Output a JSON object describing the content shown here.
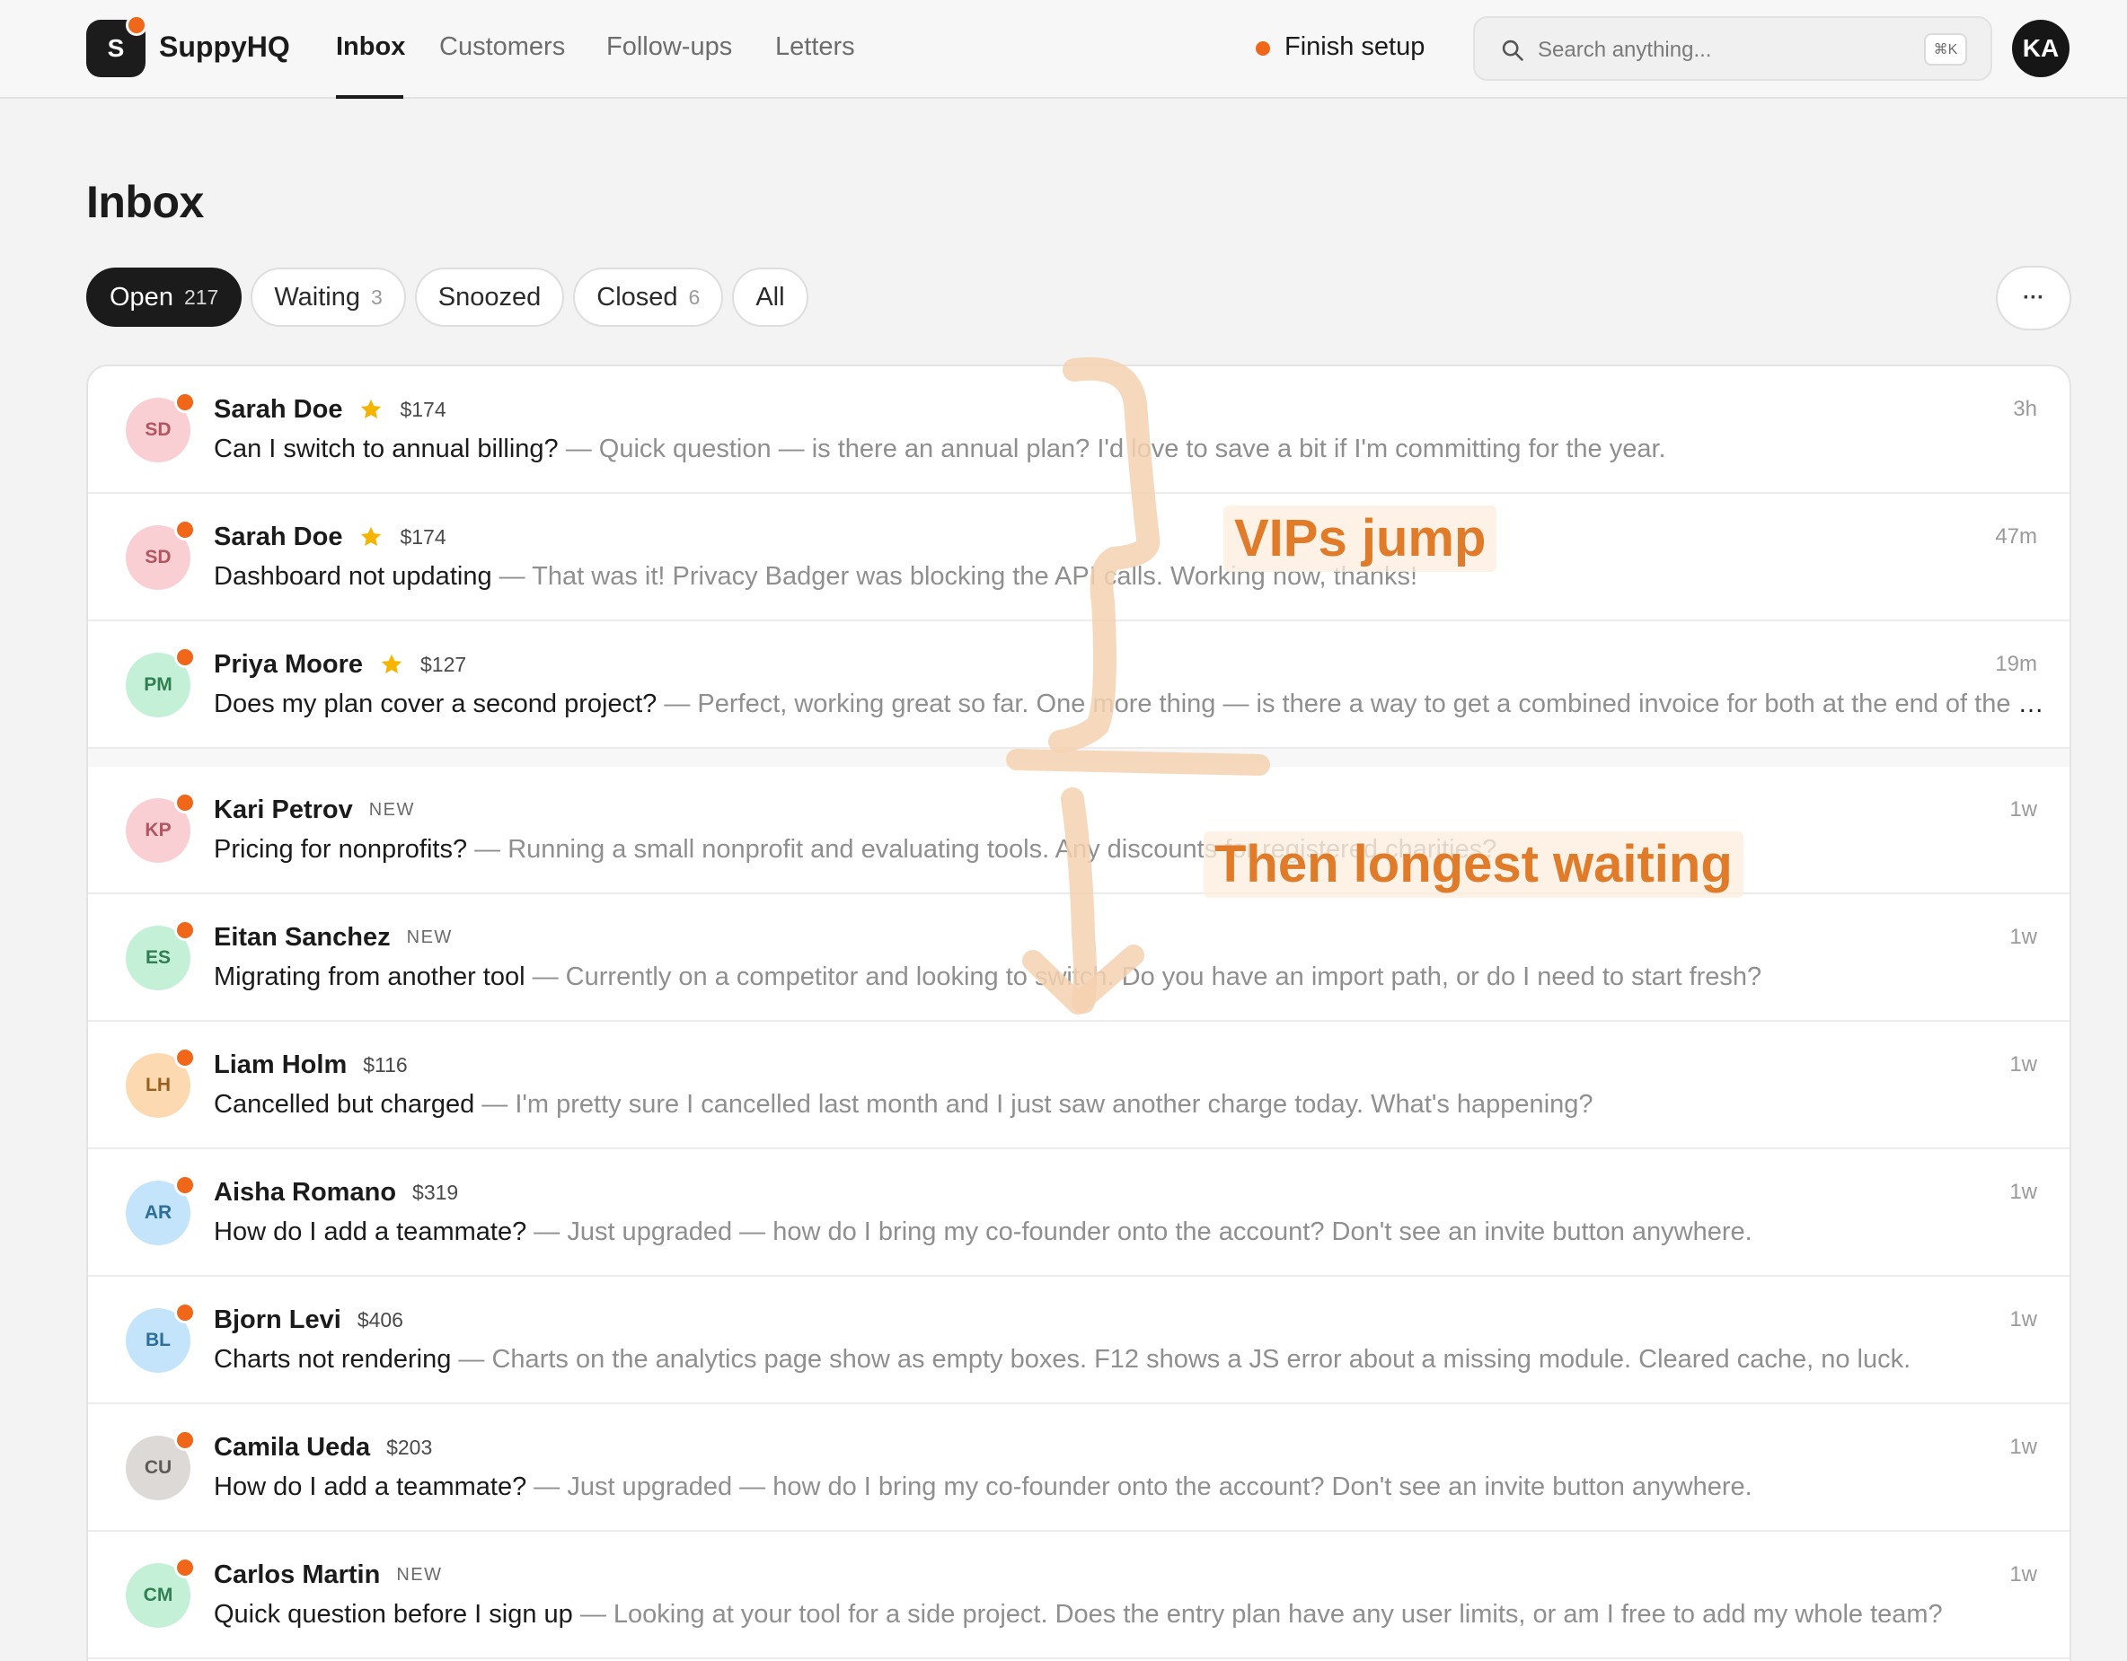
{
  "topbar": {
    "logo_letter": "S",
    "brand": "SuppyHQ",
    "nav": [
      {
        "label": "Inbox",
        "active": true
      },
      {
        "label": "Customers",
        "active": false
      },
      {
        "label": "Follow-ups",
        "active": false
      },
      {
        "label": "Letters",
        "active": false
      }
    ],
    "setup_label": "Finish setup",
    "search_placeholder": "Search anything...",
    "search_shortcut": "⌘K",
    "user_initials": "KA"
  },
  "page_title": "Inbox",
  "filters": [
    {
      "label": "Open",
      "count": "217",
      "active": true
    },
    {
      "label": "Waiting",
      "count": "3",
      "active": false
    },
    {
      "label": "Snoozed",
      "count": "",
      "active": false
    },
    {
      "label": "Closed",
      "count": "6",
      "active": false
    },
    {
      "label": "All",
      "count": "",
      "active": false
    }
  ],
  "more_label": "···",
  "conversations": [
    {
      "initials": "SD",
      "avatar_bg": "#f9cfd4",
      "avatar_fg": "#b3555f",
      "name": "Sarah Doe",
      "vip": true,
      "value": "$174",
      "badge": "",
      "subject": "Can I switch to annual billing?",
      "preview": " — Quick question — is there an annual plan? I'd love to save a bit if I'm committing for the year.",
      "time": "3h"
    },
    {
      "initials": "SD",
      "avatar_bg": "#f9cfd4",
      "avatar_fg": "#b3555f",
      "name": "Sarah Doe",
      "vip": true,
      "value": "$174",
      "badge": "",
      "subject": "Dashboard not updating",
      "preview": " — That was it! Privacy Badger was blocking the API calls. Working now, thanks!",
      "time": "47m"
    },
    {
      "initials": "PM",
      "avatar_bg": "#c3f0d6",
      "avatar_fg": "#2f7f52",
      "name": "Priya Moore",
      "vip": true,
      "value": "$127",
      "badge": "",
      "subject": "Does my plan cover a second project?",
      "preview": " — Perfect, working great so far. One more thing — is there a way to get a combined invoice for both at the end of the month?",
      "time": "19m"
    },
    {
      "initials": "KP",
      "avatar_bg": "#f9cfd4",
      "avatar_fg": "#b3555f",
      "name": "Kari Petrov",
      "vip": false,
      "value": "",
      "badge": "NEW",
      "subject": "Pricing for nonprofits?",
      "preview": " — Running a small nonprofit and evaluating tools. Any discounts for registered charities?",
      "time": "1w"
    },
    {
      "initials": "ES",
      "avatar_bg": "#c3f0d6",
      "avatar_fg": "#2f7f52",
      "name": "Eitan Sanchez",
      "vip": false,
      "value": "",
      "badge": "NEW",
      "subject": "Migrating from another tool",
      "preview": " — Currently on a competitor and looking to switch. Do you have an import path, or do I need to start fresh?",
      "time": "1w"
    },
    {
      "initials": "LH",
      "avatar_bg": "#fcd9b1",
      "avatar_fg": "#9a5f1e",
      "name": "Liam Holm",
      "vip": false,
      "value": "$116",
      "badge": "",
      "subject": "Cancelled but charged",
      "preview": " — I'm pretty sure I cancelled last month and I just saw another charge today. What's happening?",
      "time": "1w"
    },
    {
      "initials": "AR",
      "avatar_bg": "#c4e4fb",
      "avatar_fg": "#2d6d9a",
      "name": "Aisha Romano",
      "vip": false,
      "value": "$319",
      "badge": "",
      "subject": "How do I add a teammate?",
      "preview": " — Just upgraded — how do I bring my co-founder onto the account? Don't see an invite button anywhere.",
      "time": "1w"
    },
    {
      "initials": "BL",
      "avatar_bg": "#c4e4fb",
      "avatar_fg": "#2d6d9a",
      "name": "Bjorn Levi",
      "vip": false,
      "value": "$406",
      "badge": "",
      "subject": "Charts not rendering",
      "preview": " — Charts on the analytics page show as empty boxes. F12 shows a JS error about a missing module. Cleared cache, no luck.",
      "time": "1w"
    },
    {
      "initials": "CU",
      "avatar_bg": "#dcd9d7",
      "avatar_fg": "#5f5a57",
      "name": "Camila Ueda",
      "vip": false,
      "value": "$203",
      "badge": "",
      "subject": "How do I add a teammate?",
      "preview": " — Just upgraded — how do I bring my co-founder onto the account? Don't see an invite button anywhere.",
      "time": "1w"
    },
    {
      "initials": "CM",
      "avatar_bg": "#c3f0d6",
      "avatar_fg": "#2f7f52",
      "name": "Carlos Martin",
      "vip": false,
      "value": "",
      "badge": "NEW",
      "subject": "Quick question before I sign up",
      "preview": " — Looking at your tool for a side project. Does the entry plan have any user limits, or am I free to add my whole team?",
      "time": "1w"
    }
  ],
  "annotations": {
    "vip_label": "VIPs jump",
    "waiting_label": "Then longest waiting",
    "color": "#e07b2a"
  },
  "colors": {
    "accent": "#f0671a",
    "vip_star": "#f5b400"
  }
}
